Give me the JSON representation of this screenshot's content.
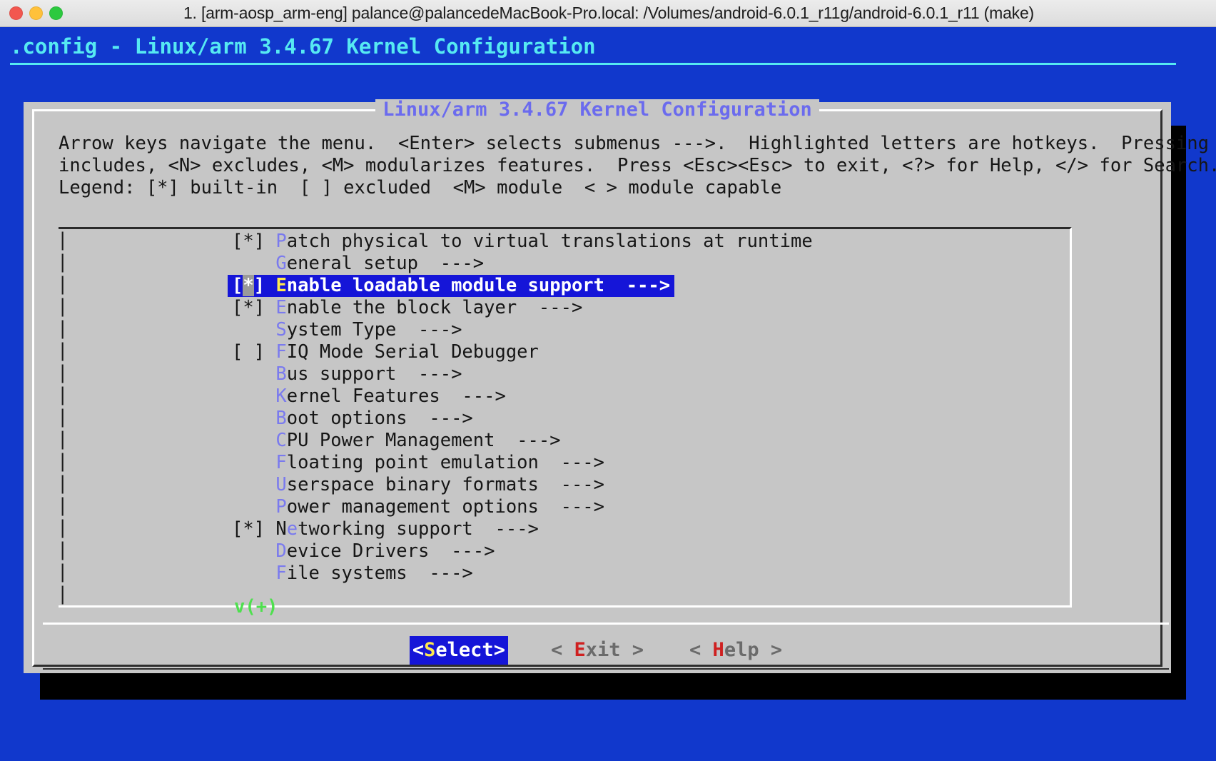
{
  "window": {
    "title": "1. [arm-aosp_arm-eng] palance@palancedeMacBook-Pro.local: /Volumes/android-6.0.1_r11g/android-6.0.1_r11 (make)",
    "traffic_lights": [
      "close-light",
      "minimize-light",
      "zoom-light"
    ]
  },
  "terminal": {
    "header": ".config - Linux/arm 3.4.67 Kernel Configuration",
    "colors": {
      "background": "#1138cc",
      "header_text": "#56e9f2",
      "dialog_background": "#c6c6c6",
      "highlight": "#1515d8",
      "hotkey": "#7a7aee",
      "hotkey_selected": "#ffe94d",
      "button_hotkey": "#cf2020",
      "scroll_hint": "#4ee04e",
      "dialog_title": "#6b6bee"
    }
  },
  "dialog": {
    "title": "Linux/arm 3.4.67 Kernel Configuration",
    "help_lines": [
      "Arrow keys navigate the menu.  <Enter> selects submenus --->.  Highlighted letters are hotkeys.  Pressing <Y>",
      "includes, <N> excludes, <M> modularizes features.  Press <Esc><Esc> to exit, <?> for Help, </> for Search.",
      "Legend: [*] built-in  [ ] excluded  <M> module  < > module capable"
    ],
    "scroll_hint": "v(+)"
  },
  "menu": {
    "items": [
      {
        "marker": "[*]",
        "hotkey": "P",
        "before": "",
        "after": "atch physical to virtual translations at runtime",
        "arrow": "",
        "selected": false
      },
      {
        "marker": "   ",
        "hotkey": "G",
        "before": "",
        "after": "eneral setup",
        "arrow": "  --->",
        "selected": false
      },
      {
        "marker": "[*]",
        "hotkey": "E",
        "before": "",
        "after": "nable loadable module support",
        "arrow": "  --->",
        "selected": true
      },
      {
        "marker": "[*]",
        "hotkey": "E",
        "before": "",
        "after": "nable the block layer",
        "arrow": "  --->",
        "selected": false
      },
      {
        "marker": "   ",
        "hotkey": "S",
        "before": "",
        "after": "ystem Type",
        "arrow": "  --->",
        "selected": false
      },
      {
        "marker": "[ ]",
        "hotkey": "F",
        "before": "",
        "after": "IQ Mode Serial Debugger",
        "arrow": "",
        "selected": false
      },
      {
        "marker": "   ",
        "hotkey": "B",
        "before": "",
        "after": "us support",
        "arrow": "  --->",
        "selected": false
      },
      {
        "marker": "   ",
        "hotkey": "K",
        "before": "",
        "after": "ernel Features",
        "arrow": "  --->",
        "selected": false
      },
      {
        "marker": "   ",
        "hotkey": "B",
        "before": "",
        "after": "oot options",
        "arrow": "  --->",
        "selected": false
      },
      {
        "marker": "   ",
        "hotkey": "C",
        "before": "",
        "after": "PU Power Management",
        "arrow": "  --->",
        "selected": false
      },
      {
        "marker": "   ",
        "hotkey": "F",
        "before": "",
        "after": "loating point emulation",
        "arrow": "  --->",
        "selected": false
      },
      {
        "marker": "   ",
        "hotkey": "U",
        "before": "",
        "after": "serspace binary formats",
        "arrow": "  --->",
        "selected": false
      },
      {
        "marker": "   ",
        "hotkey": "P",
        "before": "",
        "after": "ower management options",
        "arrow": "  --->",
        "selected": false
      },
      {
        "marker": "[*]",
        "hotkey": "e",
        "before": "N",
        "after": "tworking support",
        "arrow": "  --->",
        "selected": false
      },
      {
        "marker": "   ",
        "hotkey": "D",
        "before": "",
        "after": "evice Drivers",
        "arrow": "  --->",
        "selected": false
      },
      {
        "marker": "   ",
        "hotkey": "F",
        "before": "",
        "after": "ile systems",
        "arrow": "  --->",
        "selected": false
      }
    ]
  },
  "buttons": [
    {
      "left": "<",
      "hotkey": "S",
      "rest": "elect",
      "right": ">",
      "active": true
    },
    {
      "left": "< ",
      "hotkey": "E",
      "rest": "xit",
      "right": " >",
      "active": false
    },
    {
      "left": "< ",
      "hotkey": "H",
      "rest": "elp",
      "right": " >",
      "active": false
    }
  ]
}
